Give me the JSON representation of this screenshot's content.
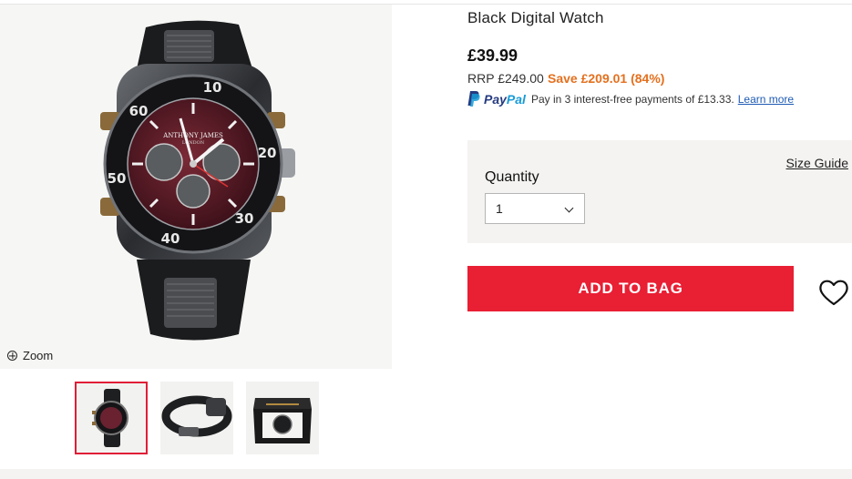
{
  "product": {
    "title": "Black Digital Watch",
    "price": "£39.99",
    "rrp": "RRP £249.00",
    "save": "Save £209.01 (84%)"
  },
  "paypal": {
    "brand_pay": "Pay",
    "brand_pal": "Pal",
    "text": "Pay in 3 interest-free payments of £13.33.",
    "link": "Learn more"
  },
  "options": {
    "size_guide": "Size Guide",
    "quantity_label": "Quantity",
    "quantity_value": "1"
  },
  "actions": {
    "add_to_bag": "ADD TO BAG"
  },
  "gallery": {
    "zoom_label": "Zoom",
    "dial_brand": "ANTHONY JAMES",
    "dial_sub": "LONDON",
    "bezel_numbers": [
      "10",
      "20",
      "30",
      "40",
      "50",
      "60"
    ]
  },
  "colors": {
    "accent": "#e91f34",
    "save": "#e4701e",
    "panel": "#f4f3f1"
  },
  "icons": [
    "zoom-icon",
    "paypal-icon",
    "chevron-down-icon",
    "heart-icon"
  ]
}
